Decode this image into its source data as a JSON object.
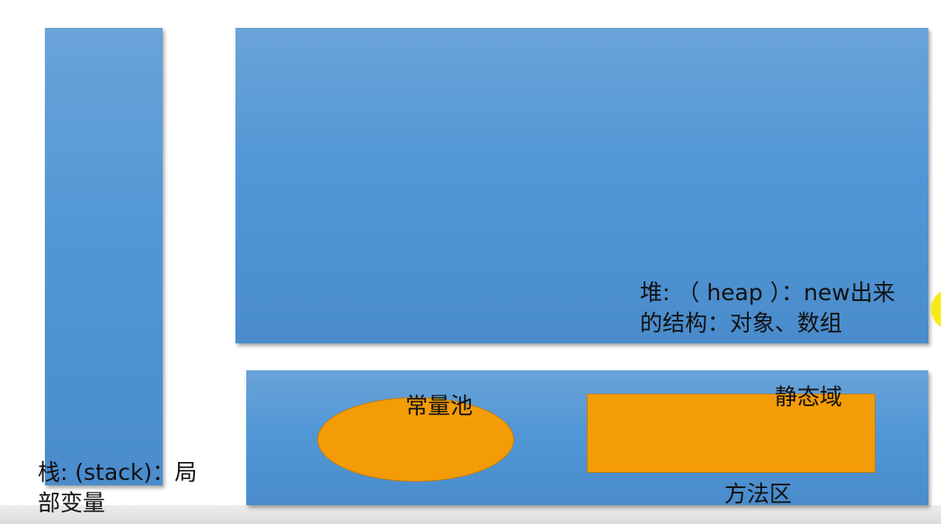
{
  "diagram": {
    "heap": {
      "label_line1": "堆: （ heap ）：new出来",
      "label_line2": "的结构：对象、数组"
    },
    "stack": {
      "label_line1": "栈: (stack)：局",
      "label_line2": "部变量"
    },
    "method_area": {
      "label": "方法区",
      "constant_pool": "常量池",
      "static_field": "静态域"
    }
  },
  "colors": {
    "block_blue": "#5197d6",
    "region_orange": "#f49c06",
    "cursor_yellow": "#f6ea18"
  }
}
